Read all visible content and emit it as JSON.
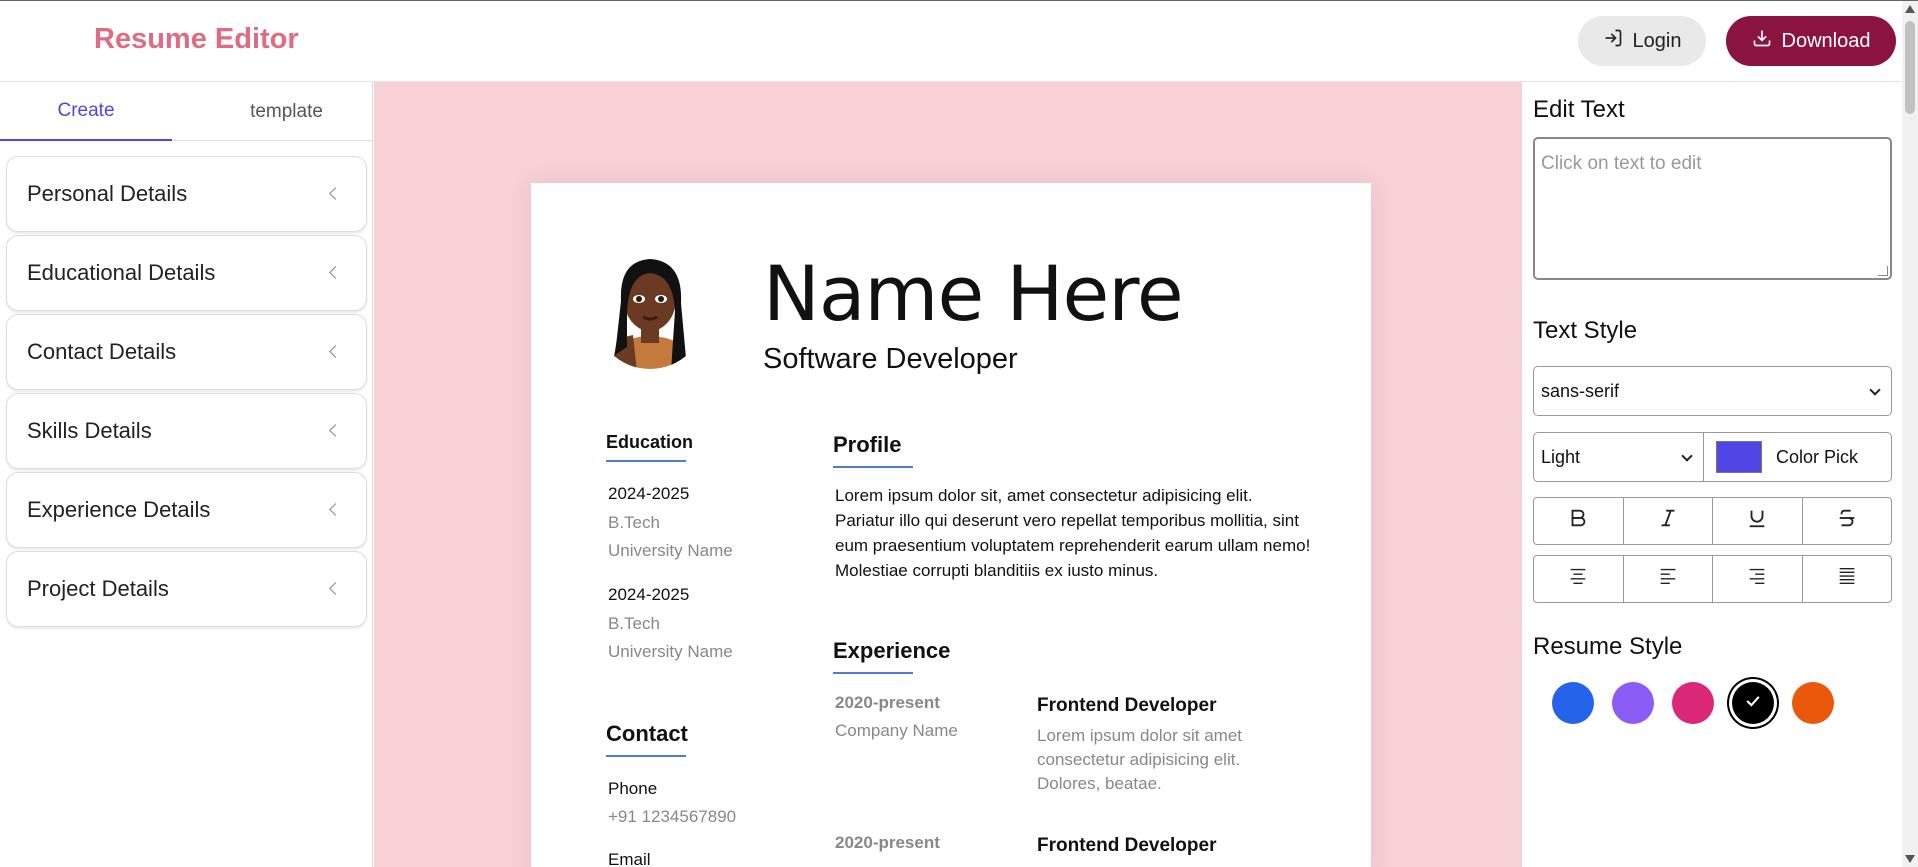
{
  "header": {
    "brand": "Resume Editor",
    "login_label": "Login",
    "download_label": "Download"
  },
  "sidebar": {
    "tabs": [
      {
        "label": "Create",
        "active": true
      },
      {
        "label": "template",
        "active": false
      }
    ],
    "sections": [
      {
        "label": "Personal Details"
      },
      {
        "label": "Educational Details"
      },
      {
        "label": "Contact Details"
      },
      {
        "label": "Skills Details"
      },
      {
        "label": "Experience Details"
      },
      {
        "label": "Project Details"
      }
    ]
  },
  "resume": {
    "name": "Name Here",
    "role": "Software Developer",
    "education_heading": "Education",
    "education": [
      {
        "years": "2024-2025",
        "degree": "B.Tech",
        "school": "University Name"
      },
      {
        "years": "2024-2025",
        "degree": "B.Tech",
        "school": "University Name"
      }
    ],
    "contact_heading": "Contact",
    "contact": [
      {
        "label": "Phone",
        "value": "+91 1234567890"
      },
      {
        "label": "Email",
        "value": ""
      }
    ],
    "profile_heading": "Profile",
    "profile_text": "Lorem ipsum dolor sit, amet consectetur adipisicing elit. Pariatur illo qui deserunt vero repellat temporibus mollitia, sint eum praesentium voluptatem reprehenderit earum ullam nemo! Molestiae corrupti blanditiis ex iusto minus.",
    "experience_heading": "Experience",
    "experience": [
      {
        "period": "2020-present",
        "company": "Company Name",
        "title": "Frontend Developer",
        "desc": "Lorem ipsum dolor sit amet consectetur adipisicing elit. Dolores, beatae."
      },
      {
        "period": "2020-present",
        "company": "",
        "title": "Frontend Developer",
        "desc": ""
      }
    ]
  },
  "editor": {
    "edit_text_heading": "Edit Text",
    "edit_text_placeholder": "Click on text to edit",
    "text_style_heading": "Text Style",
    "font_family": "sans-serif",
    "font_weight": "Light",
    "color_pick_label": "Color Pick",
    "text_color": "#4f46e5",
    "format_buttons": [
      "bold-icon",
      "italic-icon",
      "underline-icon",
      "strikethrough-icon"
    ],
    "align_buttons": [
      "align-center-icon",
      "align-left-icon",
      "align-right-icon",
      "align-justify-icon"
    ],
    "resume_style_heading": "Resume Style",
    "style_colors": [
      "#2563eb",
      "#8b5cf6",
      "#db2777",
      "#000000",
      "#ea580c"
    ],
    "selected_style_color": "#000000"
  },
  "colors": {
    "brand": "#e06b84",
    "download_bg": "#8b1342",
    "canvas_bg": "#f8d1d7",
    "accent": "#4f46e5"
  }
}
